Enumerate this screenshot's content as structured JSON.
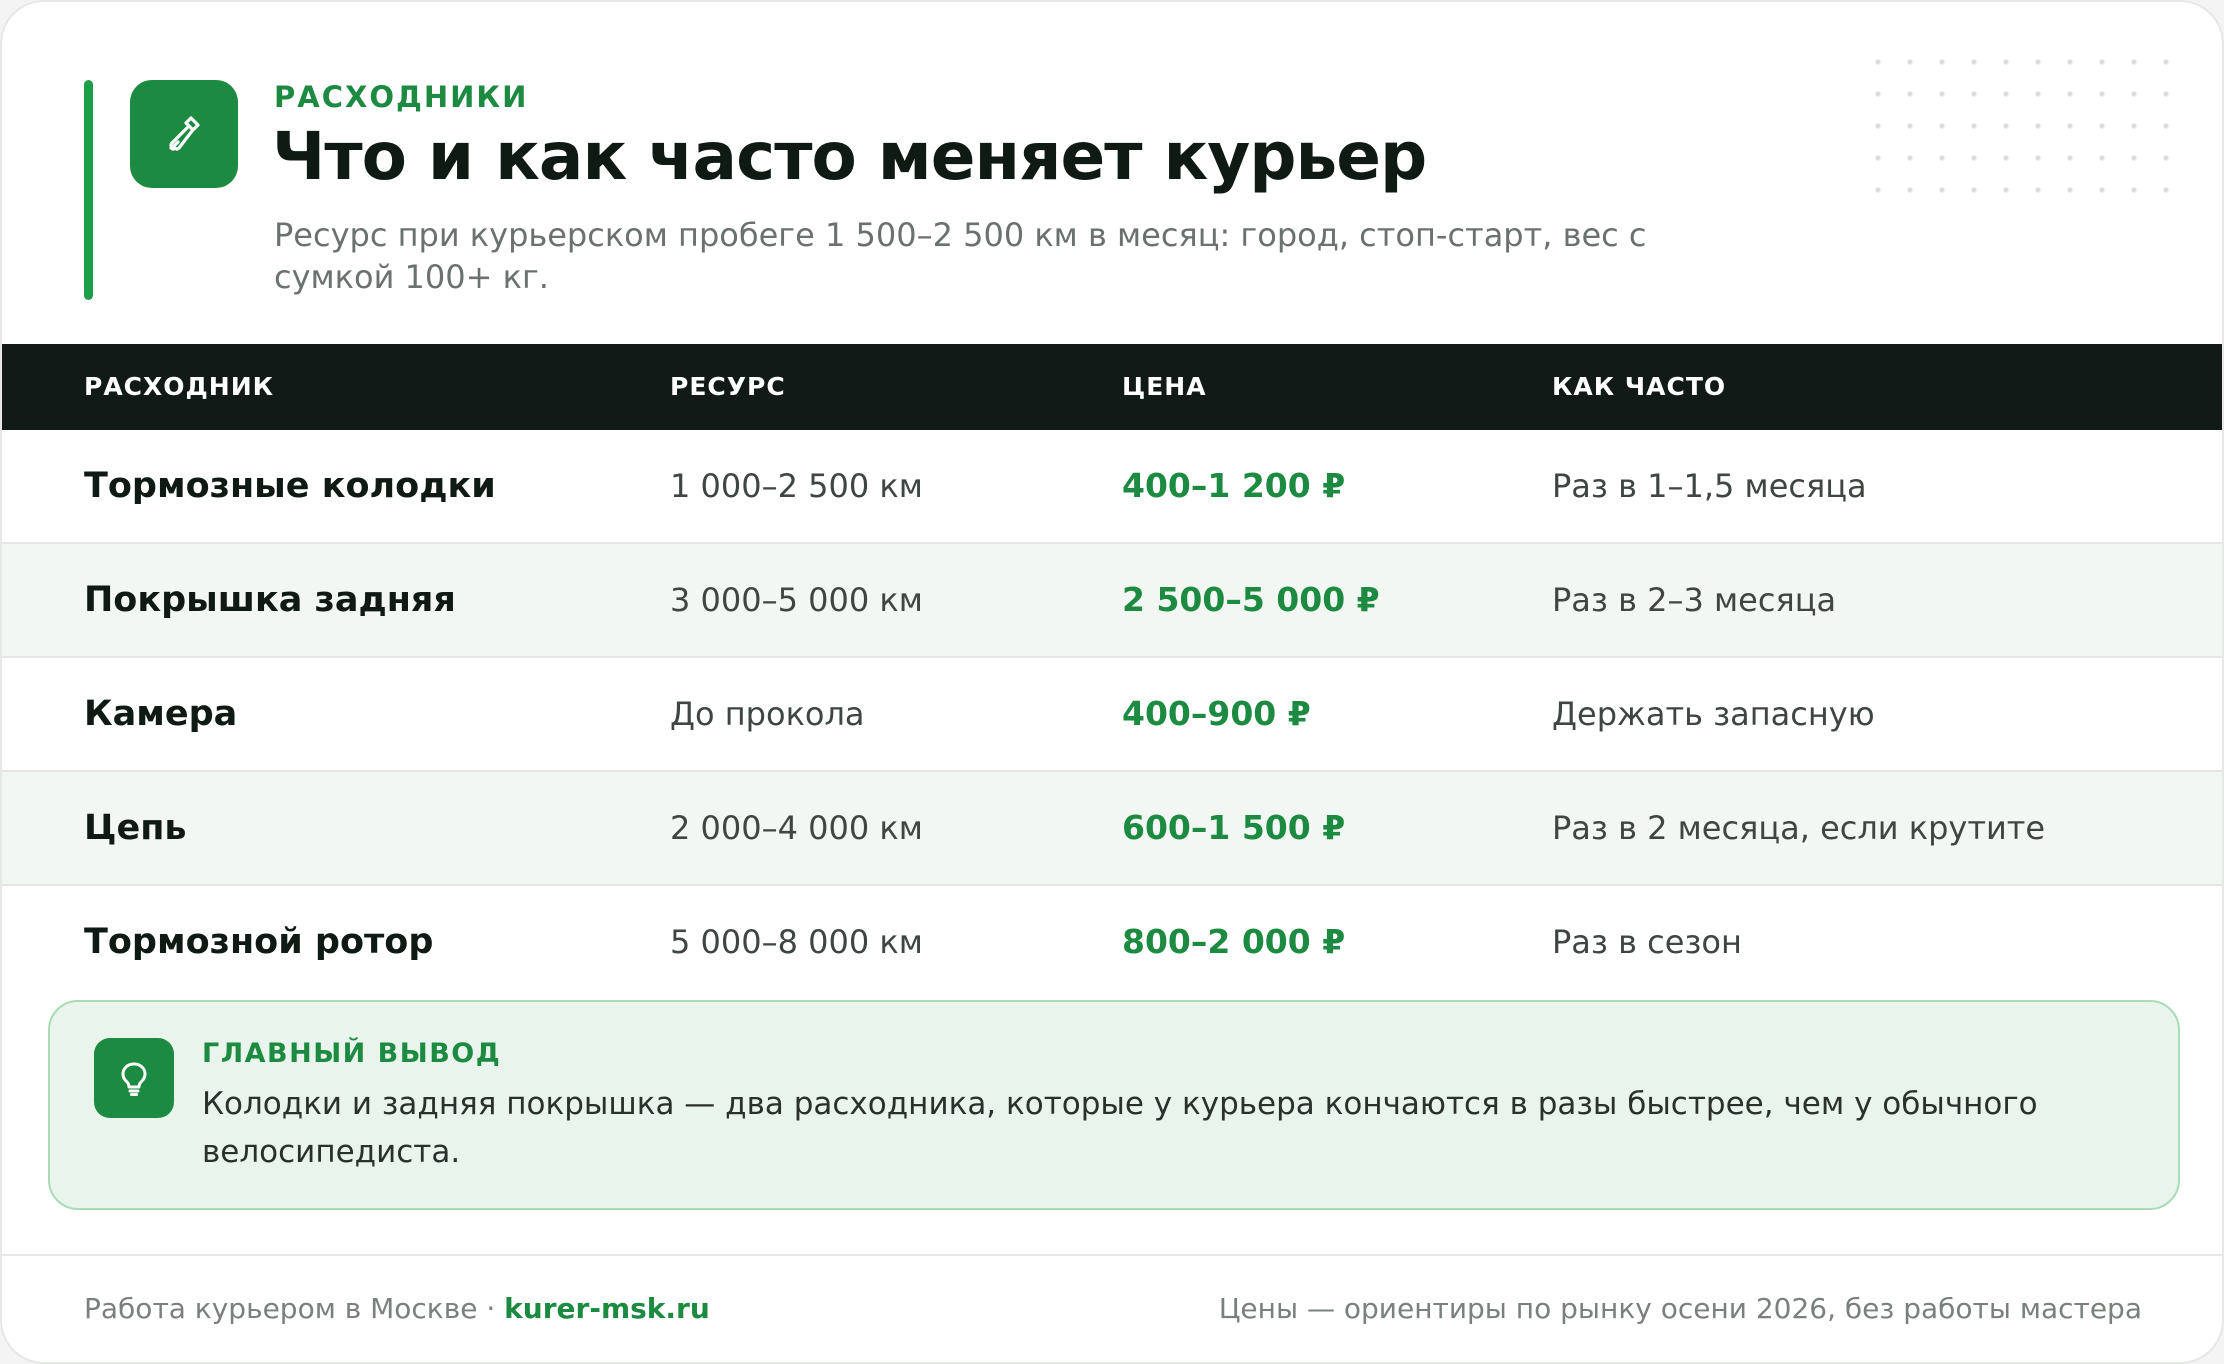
{
  "header": {
    "eyebrow": "РАСХОДНИКИ",
    "title": "Что и как часто меняет курьер",
    "subtitle": "Ресурс при курьерском пробеге 1 500–2 500 км в месяц: город, стоп-старт, вес с сумкой 100+ кг.",
    "icon": "wrench-icon"
  },
  "table": {
    "columns": [
      "РАСХОДНИК",
      "РЕСУРС",
      "ЦЕНА",
      "КАК ЧАСТО"
    ],
    "rows": [
      {
        "name": "Тормозные колодки",
        "resource": "1 000–2 500 км",
        "price": "400–1 200 ₽",
        "frequency": "Раз в 1–1,5 месяца"
      },
      {
        "name": "Покрышка задняя",
        "resource": "3 000–5 000 км",
        "price": "2 500–5 000 ₽",
        "frequency": "Раз в 2–3 месяца"
      },
      {
        "name": "Камера",
        "resource": "До прокола",
        "price": "400–900 ₽",
        "frequency": "Держать запасную"
      },
      {
        "name": "Цепь",
        "resource": "2 000–4 000 км",
        "price": "600–1 500 ₽",
        "frequency": "Раз в 2 месяца, если крутите"
      },
      {
        "name": "Тормозной ротор",
        "resource": "5 000–8 000 км",
        "price": "800–2 000 ₽",
        "frequency": "Раз в сезон"
      }
    ]
  },
  "takeaway": {
    "label": "ГЛАВНЫЙ ВЫВОД",
    "text": "Колодки и задняя покрышка — два расходника, которые у курьера кончаются в разы быстрее, чем у обычного велосипедиста.",
    "icon": "lightbulb-icon"
  },
  "footer": {
    "left_text": "Работа курьером в Москве · ",
    "site": "kurer-msk.ru",
    "right_text": "Цены — ориентиры по рынку осени 2026, без работы мастера"
  },
  "colors": {
    "accent": "#1c8a40",
    "header_bg": "#111a16",
    "alt_row": "#f3f7f3",
    "takeaway_bg": "#e9f5ec"
  }
}
